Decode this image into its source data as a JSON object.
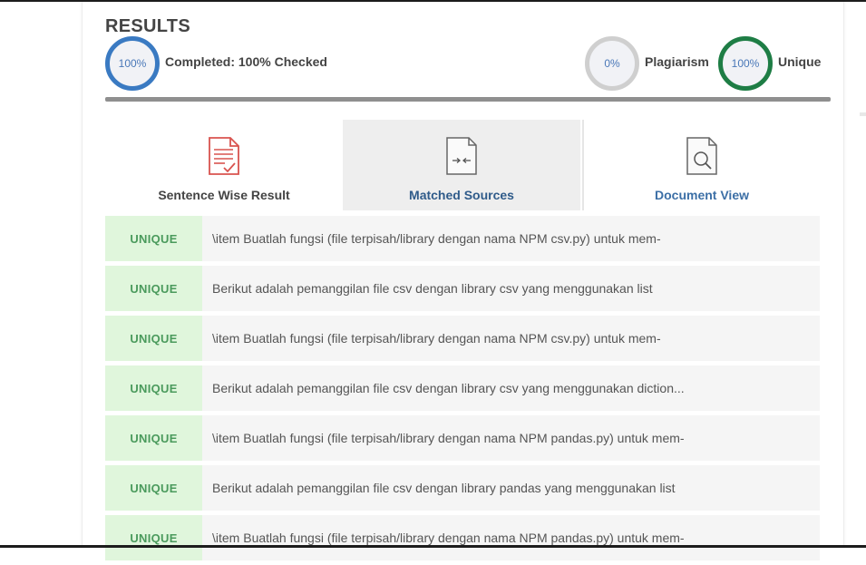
{
  "results": {
    "title": "RESULTS",
    "completed": {
      "circle_value": "100%",
      "label": "Completed: 100% Checked"
    },
    "plagiarism": {
      "circle_value": "0%",
      "label": "Plagiarism"
    },
    "unique": {
      "circle_value": "100%",
      "label": "Unique"
    },
    "progress_fraction": 1.0
  },
  "tabs": [
    {
      "label": "Sentence Wise Result",
      "icon": "document-check-icon",
      "active": false
    },
    {
      "label": "Matched Sources",
      "icon": "document-compare-icon",
      "active": true
    },
    {
      "label": "Document View",
      "icon": "document-search-icon",
      "active": false
    }
  ],
  "rows": [
    {
      "badge": "UNIQUE",
      "text": "\\item Buatlah fungsi (file terpisah/library dengan nama NPM csv.py) untuk mem-"
    },
    {
      "badge": "UNIQUE",
      "text": "Berikut adalah pemanggilan file csv dengan library csv yang menggunakan list"
    },
    {
      "badge": "UNIQUE",
      "text": "\\item Buatlah fungsi (file terpisah/library dengan nama NPM csv.py) untuk mem-"
    },
    {
      "badge": "UNIQUE",
      "text": "Berikut adalah pemanggilan file csv dengan library csv yang menggunakan diction..."
    },
    {
      "badge": "UNIQUE",
      "text": "\\item Buatlah fungsi (file terpisah/library dengan nama NPM pandas.py) untuk mem-"
    },
    {
      "badge": "UNIQUE",
      "text": "Berikut adalah pemanggilan file csv dengan library pandas yang menggunakan list"
    },
    {
      "badge": "UNIQUE",
      "text": "\\item Buatlah fungsi (file terpisah/library dengan nama NPM pandas.py) untuk mem-"
    }
  ],
  "colors": {
    "completed_ring": "#3a7ac2",
    "plagiarism_ring": "#cfcfcf",
    "unique_ring": "#1e7d45",
    "unique_badge_bg": "#e0f6dc",
    "unique_badge_text": "#4a9a5c"
  }
}
